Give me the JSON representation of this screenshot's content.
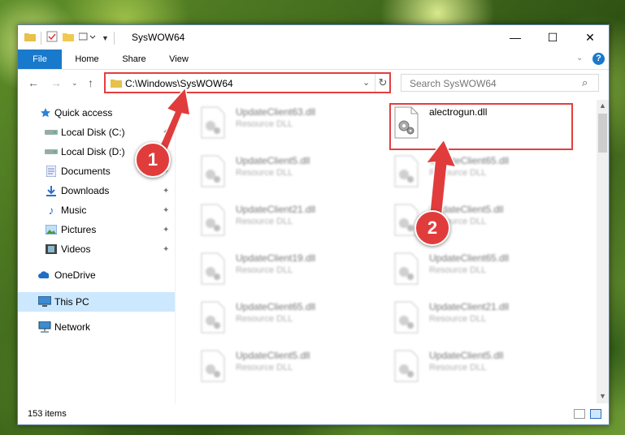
{
  "window": {
    "title": "SysWOW64",
    "controls": {
      "minimize": "—",
      "maximize": "☐",
      "close": "✕"
    }
  },
  "ribbon": {
    "tabs": [
      {
        "label": "File"
      },
      {
        "label": "Home"
      },
      {
        "label": "Share"
      },
      {
        "label": "View"
      }
    ]
  },
  "address": {
    "path": "C:\\Windows\\SysWOW64",
    "search_placeholder": "Search SysWOW64"
  },
  "nav": {
    "items": [
      {
        "label": "Quick access",
        "icon": "star-icon"
      },
      {
        "label": "Local Disk (C:)",
        "icon": "drive-icon"
      },
      {
        "label": "Local Disk (D:)",
        "icon": "drive-icon"
      },
      {
        "label": "Documents",
        "icon": "documents-icon"
      },
      {
        "label": "Downloads",
        "icon": "download-icon"
      },
      {
        "label": "Music",
        "icon": "music-icon"
      },
      {
        "label": "Pictures",
        "icon": "pictures-icon"
      },
      {
        "label": "Videos",
        "icon": "videos-icon"
      },
      {
        "label": "OneDrive",
        "icon": "cloud-icon"
      },
      {
        "label": "This PC",
        "icon": "computer-icon"
      },
      {
        "label": "Network",
        "icon": "network-icon"
      }
    ],
    "selected": "This PC"
  },
  "files": {
    "left_column": [
      {
        "name": "UpdateClient63.dll",
        "type": "Resource DLL"
      },
      {
        "name": "UpdateClient5.dll",
        "type": "Resource DLL"
      },
      {
        "name": "UpdateClient21.dll",
        "type": "Resource DLL"
      },
      {
        "name": "UpdateClient19.dll",
        "type": "Resource DLL"
      },
      {
        "name": "UpdateClient65.dll",
        "type": "Resource DLL"
      },
      {
        "name": "UpdateClient5.dll",
        "type": "Resource DLL"
      }
    ],
    "right_column": [
      {
        "name": "alectrogun.dll",
        "type": ""
      },
      {
        "name": "UpdateClient65.dll",
        "type": "Resource DLL"
      },
      {
        "name": "UpdateClient5.dll",
        "type": "Resource DLL"
      },
      {
        "name": "UpdateClient65.dll",
        "type": "Resource DLL"
      },
      {
        "name": "UpdateClient21.dll",
        "type": "Resource DLL"
      },
      {
        "name": "UpdateClient5.dll",
        "type": "Resource DLL"
      }
    ]
  },
  "status": {
    "item_count": "153 items"
  },
  "callouts": [
    {
      "number": "1"
    },
    {
      "number": "2"
    }
  ],
  "colors": {
    "accent": "#1979ca",
    "highlight": "#e53e3e",
    "selected_bg": "#cce8ff"
  }
}
